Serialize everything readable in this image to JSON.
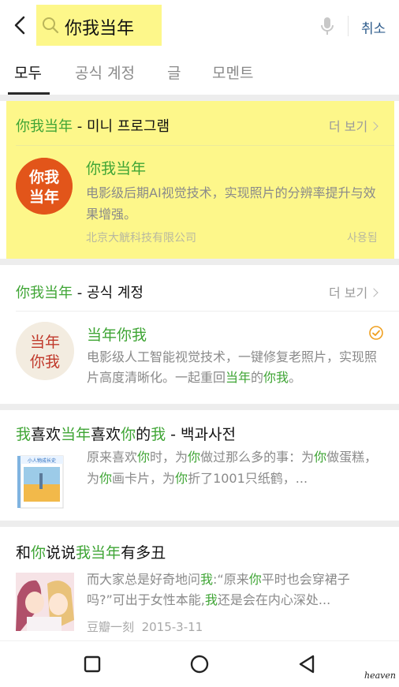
{
  "search": {
    "query": "你我当年",
    "cancel_label": "취소"
  },
  "tabs": [
    {
      "label": "모두"
    },
    {
      "label": "공식 계정"
    },
    {
      "label": "글"
    },
    {
      "label": "모멘트"
    }
  ],
  "mini_program": {
    "section_title_highlight": "你我当年",
    "section_title_suffix": " - 미니 프로그램",
    "more_label": "더 보기",
    "logo_text_top": "你我",
    "logo_text_bottom": "当年",
    "name": "你我当年",
    "description": "电影级后期AI视觉技术，实现照片的分辨率提升与效果增强。",
    "company": "北京大觥科技有限公司",
    "used_label": "사용됨"
  },
  "official_account": {
    "section_title_highlight": "你我当年",
    "section_title_suffix": " - 공식 계정",
    "more_label": "더 보기",
    "avatar_text_top": "当年",
    "avatar_text_bottom": "你我",
    "name": "当年你我",
    "desc_part1": "电影级人工智能视觉技术，一键修复老照片，实现照片高度清晰化。一起重回",
    "desc_hl1": "当年",
    "desc_part2": "的",
    "desc_hl2": "你我",
    "desc_part3": "。"
  },
  "encyclopedia": {
    "title_parts": [
      "我",
      "喜欢",
      "当年",
      "喜欢",
      "你",
      "的",
      "我",
      " - 백과사전"
    ],
    "book_label": "小人物成长史",
    "desc_parts": [
      "原来喜欢",
      "你",
      "时，为",
      "你",
      "做过那么多的事：为",
      "你",
      "做蛋糕，为",
      "你",
      "画卡片，为",
      "你",
      "折了1001只纸鹤，..."
    ]
  },
  "article": {
    "title_parts": [
      "和",
      "你",
      "说说",
      "我当年",
      "有多丑"
    ],
    "desc_parts": [
      "而大家总是好奇地问",
      "我",
      ":“原来",
      "你",
      "平时也会穿裙子吗?”可出于女性本能,",
      "我",
      "还是会在内心深处..."
    ],
    "source": "豆瓣一刻",
    "date": "2015-3-11"
  },
  "watermark": "heaven",
  "colors": {
    "highlight_yellow": "#fdf78a",
    "match_green": "#3fa535",
    "link_blue": "#2e5c8c",
    "logo_orange": "#e2551a"
  }
}
